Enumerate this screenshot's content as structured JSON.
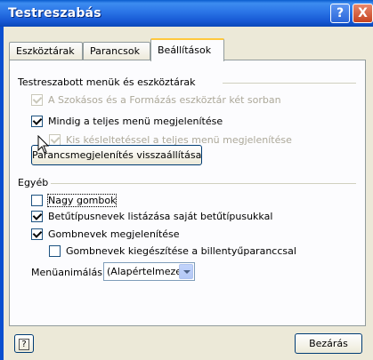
{
  "window": {
    "title": "Testreszabás",
    "help_button_glyph": "?",
    "close_button_glyph": "X"
  },
  "tabs": [
    {
      "label": "Eszköztárak",
      "active": false
    },
    {
      "label": "Parancsok",
      "active": false
    },
    {
      "label": "Beállítások",
      "active": true
    }
  ],
  "menus_group": {
    "heading": "Testreszabott menük és eszköztárak",
    "options": [
      {
        "label": "A Szokásos és a Formázás eszköztár két sorban",
        "checked": true,
        "enabled": false
      },
      {
        "label": "Mindig a teljes menü megjelenítése",
        "checked": true,
        "enabled": true
      },
      {
        "label": "Kis késleltetéssel a teljes menü megjelenítése",
        "checked": true,
        "enabled": false
      }
    ],
    "reset_button_label": "Parancsmegjelenítés visszaállítása"
  },
  "other_group": {
    "heading": "Egyéb",
    "options": [
      {
        "label": "Nagy gombok",
        "checked": false,
        "enabled": true
      },
      {
        "label": "Betűtípusnevek listázása saját betűtípusukkal",
        "checked": true,
        "enabled": true
      },
      {
        "label": "Gombnevek megjelenítése",
        "checked": true,
        "enabled": true
      },
      {
        "label": "Gombnevek kiegészítése a billentyűparanccsal",
        "checked": false,
        "enabled": true
      }
    ],
    "menu_animation": {
      "label": "Menüanimálás:",
      "selected": "(Alapértelmezett)"
    }
  },
  "footer": {
    "help_icon": "?",
    "close_label": "Bezárás"
  },
  "colors": {
    "titlebar": "#0a5ccd",
    "dialog_bg": "#ece9d8",
    "checkmark": "#21a121",
    "active_tab_accent": "#ffc83c"
  }
}
